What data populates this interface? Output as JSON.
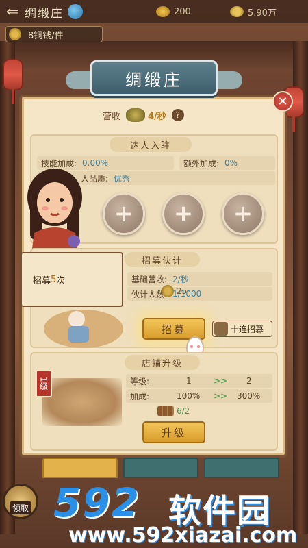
{
  "topbar": {
    "back_icon": "arrow-left-icon",
    "title": "绸缎庄",
    "ingot_value": "200",
    "coin_value": "5.90万"
  },
  "price_pill": {
    "label": "8铜钱/件"
  },
  "panel": {
    "title": "绸缎庄",
    "income_label": "营收",
    "income_value": "4/秒",
    "help_label": "?"
  },
  "talent": {
    "title": "达人入驻",
    "skill_bonus_label": "技能加成:",
    "skill_bonus_value": "0.00%",
    "extra_bonus_label": "额外加成:",
    "extra_bonus_value": "0%",
    "quality_label": "人品质:",
    "quality_value": "优秀",
    "slots": [
      "+",
      "+",
      "+"
    ]
  },
  "recruit": {
    "title": "招募伙计",
    "base_income_label": "基础营收:",
    "base_income_value": "2/秒",
    "staff_label": "伙计人数:",
    "staff_value": "1/1000",
    "cost": "25",
    "recruit_button": "招募",
    "ten_button": "十连招募",
    "tooltip_prefix": "招募",
    "tooltip_number": "5",
    "tooltip_suffix": "次"
  },
  "shop_upgrade": {
    "title": "店铺升级",
    "level_badge": "1级",
    "level_label": "等级:",
    "level_from": "1",
    "level_to": "2",
    "bonus_label": "加成:",
    "bonus_from": "100%",
    "bonus_to": "300%",
    "arrow": ">>",
    "wood_cost": "6/2",
    "upgrade_button": "升级"
  },
  "claim_button": {
    "label": "领取"
  },
  "watermark": {
    "number": "592",
    "name": "软件园",
    "url": "www.592xiazai.com"
  },
  "colors": {
    "accent_gold": "#e4b24a",
    "banner_teal": "#4f6f7c",
    "panel_bg": "#f4e6c6",
    "value_blue": "#3e7f9a",
    "arrow_green": "#59a35a",
    "watermark_blue": "#2a8fe6"
  }
}
